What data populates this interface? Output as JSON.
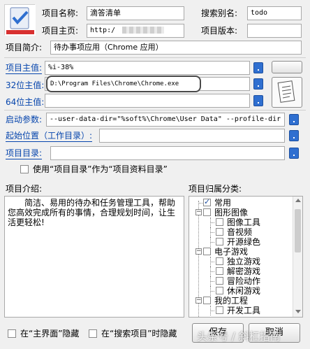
{
  "header": {
    "name_label": "项目名称:",
    "name_value": "滴答清单",
    "alias_label": "搜索别名:",
    "alias_value": "todo",
    "homepage_label": "项目主页:",
    "homepage_value": "http:/",
    "version_label": "项目版本:",
    "version_value": "",
    "intro_short_label": "项目简介:",
    "intro_short_value": "待办事项应用（Chrome 应用）"
  },
  "paths": {
    "main_label": "项目主值:",
    "main_value": "%i-38%",
    "x32_label": "32位主值:",
    "x32_value": "D:\\Program Files\\Chrome\\Chrome.exe",
    "x64_label": "64位主值:",
    "x64_value": "",
    "args_label": "启动参数:",
    "args_value": "--user-data-dir=\"%soft%\\Chrome\\User Data\" --profile-dir",
    "startpos_label": "起始位置（工作目录）:",
    "startpos_value": "",
    "projdir_label": "项目目录:",
    "projdir_value": "",
    "use_dir_label": "使用“项目目录”作为“项目资料目录”"
  },
  "description": {
    "label": "项目介绍:",
    "text": "简洁、易用的待办和任务管理工具，帮助您高效完成所有的事情，合理规划时间，让生活更轻松!"
  },
  "categories": {
    "label": "项目归属分类:",
    "items": [
      {
        "label": "常用",
        "checked": true
      },
      {
        "label": "图形图像",
        "checked": false
      },
      {
        "label": "图像工具",
        "checked": false
      },
      {
        "label": "音视频",
        "checked": false
      },
      {
        "label": "开源绿色",
        "checked": false
      },
      {
        "label": "电子游戏",
        "checked": false
      },
      {
        "label": "独立游戏",
        "checked": false
      },
      {
        "label": "解密游戏",
        "checked": false
      },
      {
        "label": "冒险动作",
        "checked": false
      },
      {
        "label": "休闲游戏",
        "checked": false
      },
      {
        "label": "我的工程",
        "checked": false
      },
      {
        "label": "开发工具",
        "checked": false
      }
    ]
  },
  "footer": {
    "hide_main_label": "在“主界面”隐藏",
    "hide_search_label": "在“搜索项目”时隐藏",
    "save_label": "保存",
    "cancel_label": "取消",
    "watermark": "头条号 / 斜杠指南"
  },
  "colors": {
    "accent": "#2f6fd0",
    "link": "#0645ad",
    "highlight_border": "#4a4a4a"
  }
}
